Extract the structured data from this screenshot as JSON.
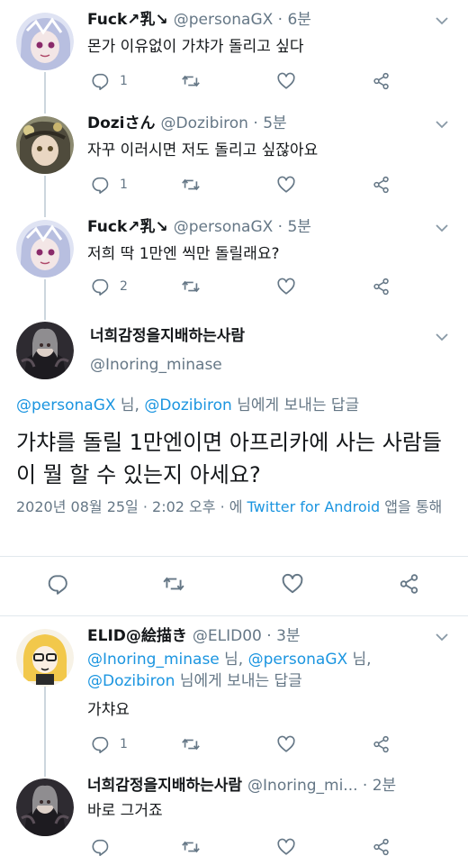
{
  "tweets": [
    {
      "name": "Fuck↗乳↘",
      "handle": "@personaGX",
      "time": "6분",
      "text": "몬가 이유없이 가챠가 돌리고 싶다",
      "replies": "1",
      "avatar_color": "#6a73a8"
    },
    {
      "name": "Doziさん",
      "handle": "@Dozibiron",
      "time": "5분",
      "text": "자꾸 이러시면 저도 돌리고 싶잖아요",
      "replies": "1",
      "avatar_color": "#6f6a55"
    },
    {
      "name": "Fuck↗乳↘",
      "handle": "@personaGX",
      "time": "5분",
      "text": "저희 딱 1만엔 씩만 돌릴래요?",
      "replies": "2",
      "avatar_color": "#6a73a8"
    }
  ],
  "main": {
    "name": "너희감정을지배하는사람",
    "handle": "@Inoring_minase",
    "reply_mention_1": "@personaGX",
    "reply_sep_1": " 님, ",
    "reply_mention_2": "@Dozibiron",
    "reply_tail": " 님에게 보내는 답글",
    "text": "가챠를 돌릴 1만엔이면 아프리카에 사는 사람들이 뭘 할 수 있는지 아세요?",
    "date": "2020년 08월 25일 · 2:02 오후 · 에 ",
    "source": "Twitter for Android",
    "source_tail": " 앱을 통해",
    "avatar_color": "#3d3a3f"
  },
  "reply1": {
    "name": "ELID@絵描き",
    "handle": "@ELID00",
    "time": "3분",
    "mention_1": "@Inoring_minase",
    "sep_1": " 님, ",
    "mention_2": "@personaGX",
    "sep_2": " 님,",
    "mention_3": "@Dozibiron",
    "tail": " 님에게 보내는 답글",
    "text": "가챠요",
    "replies": "1",
    "avatar_color": "#f2c84b"
  },
  "reply2": {
    "name": "너희감정을지배하는사람",
    "handle": "@Inoring_mi...",
    "time": "2분",
    "text": "바로 그거죠",
    "avatar_color": "#3d3a3f"
  },
  "separator": "·"
}
